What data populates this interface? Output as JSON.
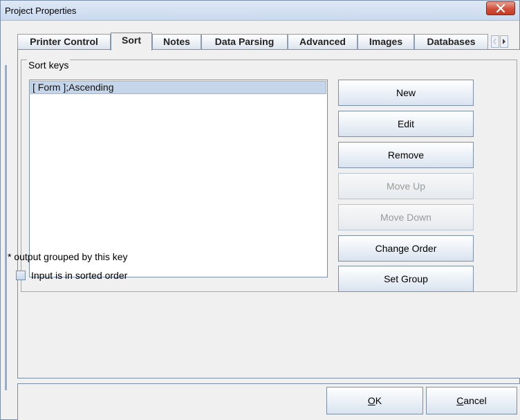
{
  "window": {
    "title": "Project Properties",
    "close_symbol": "X"
  },
  "tabs": [
    {
      "label": "Printer Control",
      "active": false
    },
    {
      "label": "Sort",
      "active": true
    },
    {
      "label": "Notes",
      "active": false
    },
    {
      "label": "Data Parsing",
      "active": false
    },
    {
      "label": "Advanced",
      "active": false
    },
    {
      "label": "Images",
      "active": false
    },
    {
      "label": "Databases",
      "active": false
    }
  ],
  "sort_keys": {
    "legend": "Sort keys",
    "items": [
      "[ Form ];Ascending"
    ],
    "selected_index": 0
  },
  "buttons": {
    "new": "New",
    "edit": "Edit",
    "remove": "Remove",
    "move_up": "Move Up",
    "move_down": "Move Down",
    "change_order": "Change Order",
    "set_group": "Set Group"
  },
  "note": "* output grouped by this key",
  "checkbox": {
    "label": "Input is in sorted order",
    "checked": false
  },
  "dialog": {
    "ok_mnemonic": "O",
    "ok_rest": "K",
    "cancel_mnemonic": "C",
    "cancel_rest": "ancel"
  },
  "colors": {
    "accent": "#c6d6ea",
    "close": "#d2503a",
    "border": "#7a8ea8"
  }
}
